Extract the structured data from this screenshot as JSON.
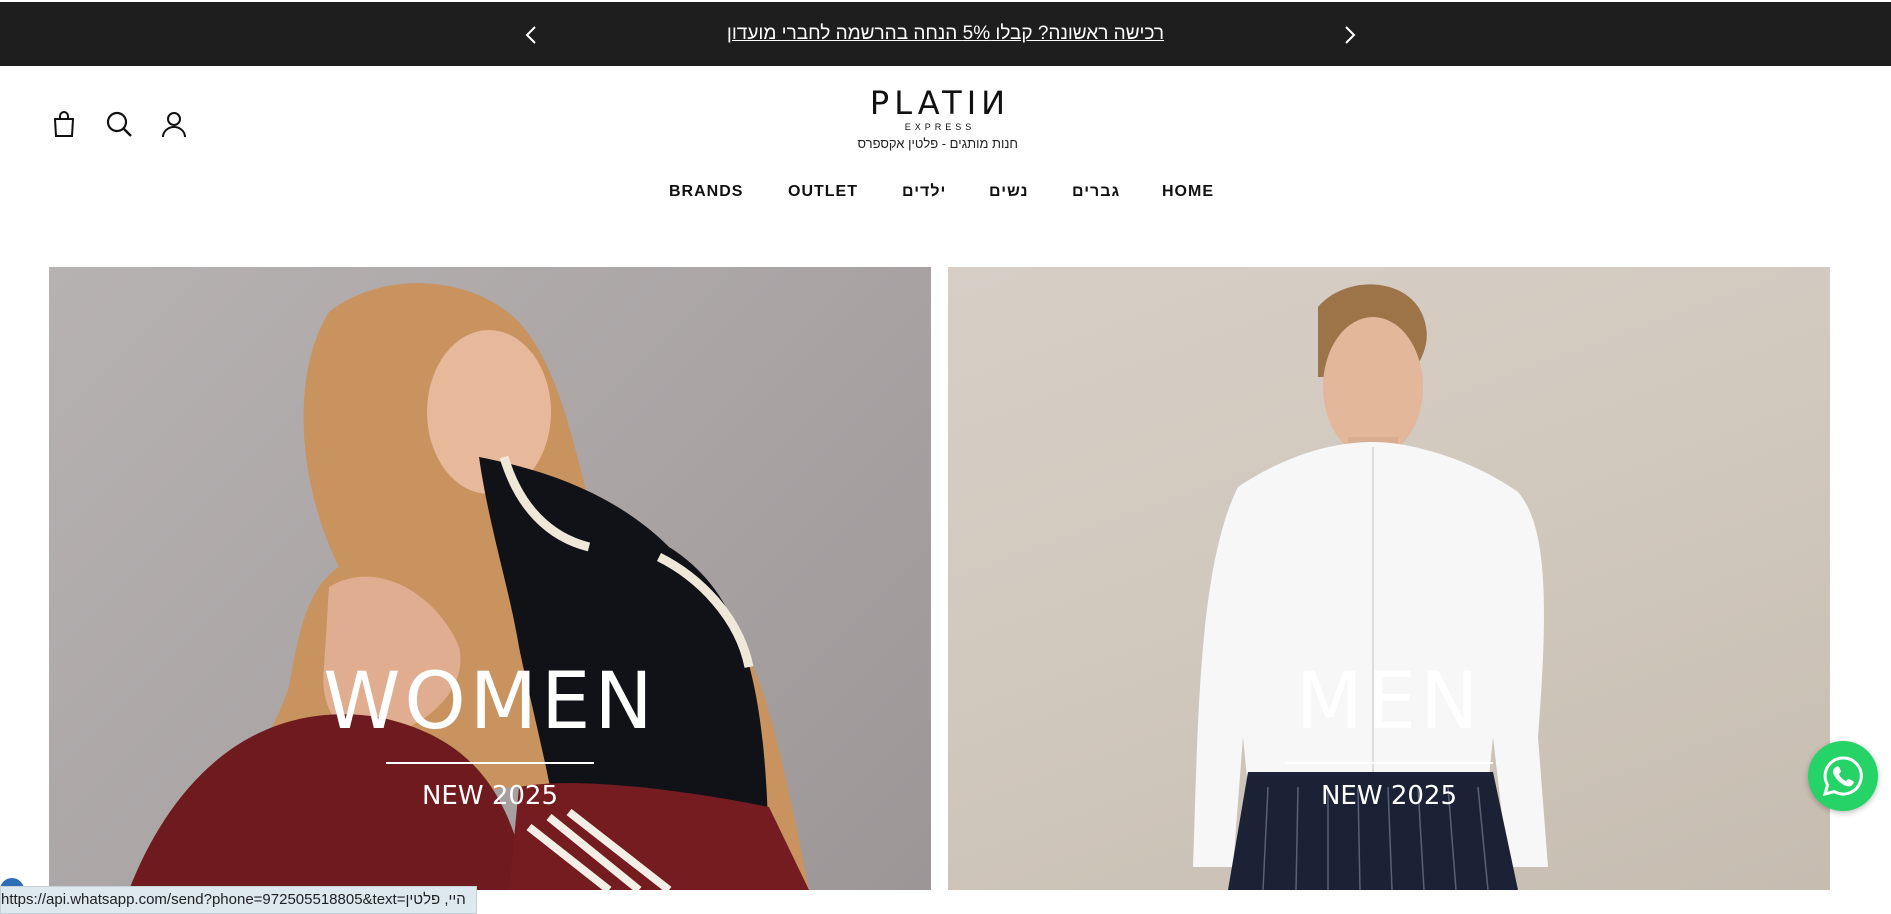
{
  "announcement": {
    "text": "רכישה ראשונה? קבלו 5% הנחה בהרשמה לחברי מועדון",
    "prev_icon": "chevron-left-icon",
    "next_icon": "chevron-right-icon"
  },
  "header": {
    "logo": {
      "word": "PLATIИ",
      "sub": "EXPRESS",
      "tagline": "חנות מותגים - פלטין אקספרס"
    },
    "icons": [
      "shopping-bag-icon",
      "search-icon",
      "account-icon"
    ]
  },
  "nav": {
    "items": [
      {
        "label": "BRANDS"
      },
      {
        "label": "OUTLET"
      },
      {
        "label": "ילדים"
      },
      {
        "label": "נשים"
      },
      {
        "label": "גברים"
      },
      {
        "label": "HOME"
      }
    ]
  },
  "banners": {
    "women": {
      "title": "WOMEN",
      "subtitle": "NEW 2025"
    },
    "men": {
      "title": "MEN",
      "subtitle": "NEW 2025"
    }
  },
  "whatsapp": {
    "icon": "whatsapp-icon",
    "color": "#25d366"
  },
  "status_bar": {
    "url": "https://api.whatsapp.com/send?phone=972505518805&text=היי, פלטין"
  },
  "colors": {
    "announcement_bg": "#1e1e1e",
    "accent_whatsapp": "#25d366"
  }
}
